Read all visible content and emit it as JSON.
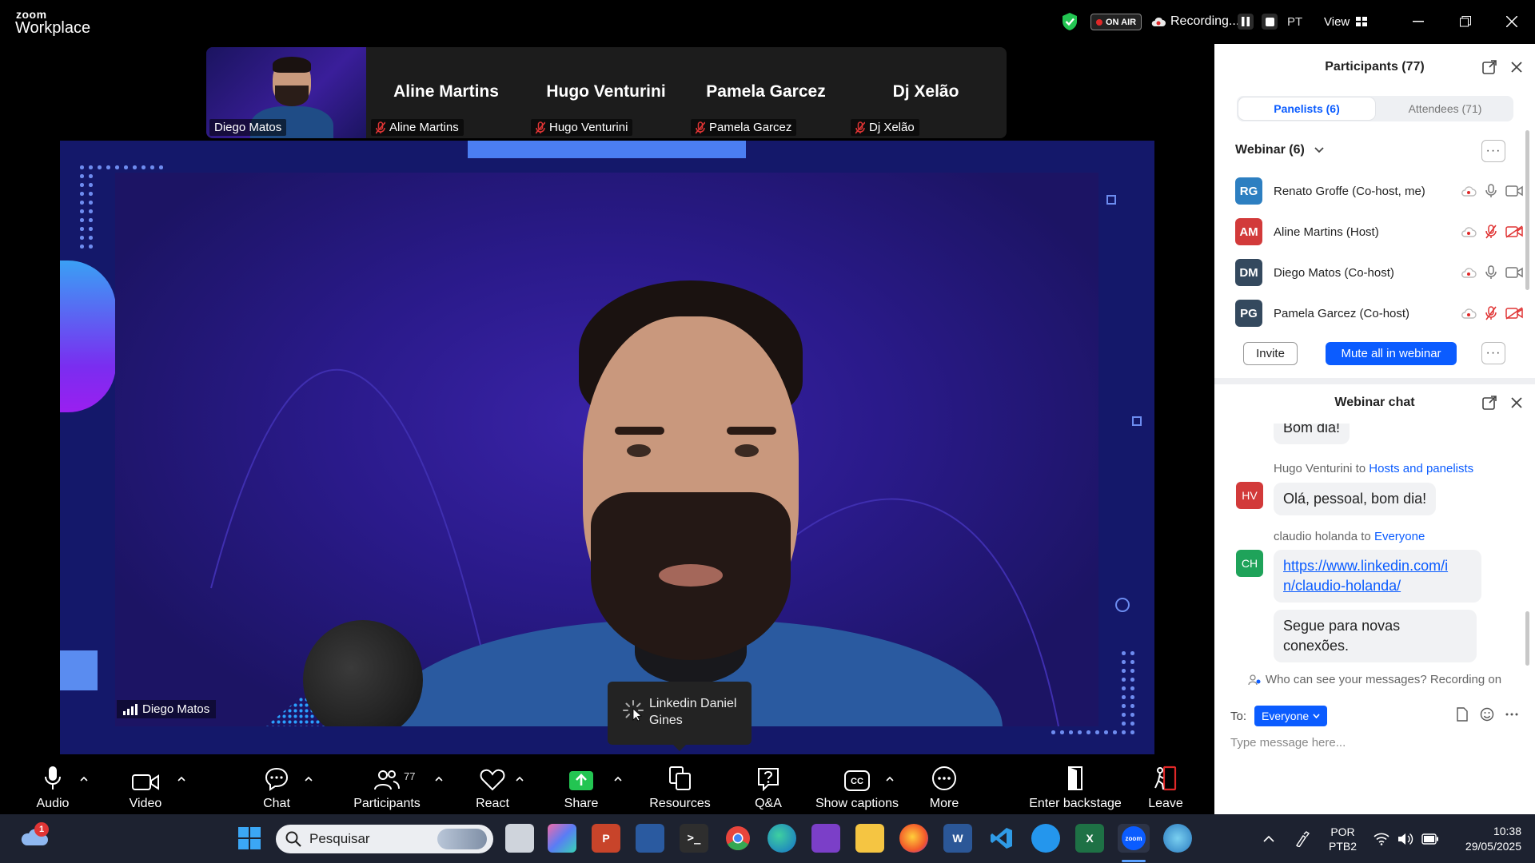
{
  "app": {
    "logo_top": "zoom",
    "logo_bottom": "Workplace",
    "on_air": "ON AIR",
    "recording": "Recording...",
    "language": "PT",
    "view": "View"
  },
  "gallery": {
    "self_label": "Diego Matos",
    "tiles": [
      {
        "name": "Aline Martins",
        "label": "Aline Martins"
      },
      {
        "name": "Hugo Venturini",
        "label": "Hugo Venturini"
      },
      {
        "name": "Pamela Garcez",
        "label": "Pamela Garcez"
      },
      {
        "name": "Dj Xelão",
        "label": "Dj Xelão"
      }
    ]
  },
  "stage": {
    "speaker_label": "Diego Matos",
    "tooltip": "Linkedin Daniel Gines"
  },
  "toolbar": {
    "audio": "Audio",
    "video": "Video",
    "chat": "Chat",
    "participants": "Participants",
    "participants_count": "77",
    "react": "React",
    "share": "Share",
    "resources": "Resources",
    "qa": "Q&A",
    "captions": "Show captions",
    "more": "More",
    "backstage": "Enter backstage",
    "leave": "Leave"
  },
  "participants_panel": {
    "title": "Participants (77)",
    "tab_panelists": "Panelists (6)",
    "tab_attendees": "Attendees (71)",
    "group": "Webinar (6)",
    "rows": [
      {
        "initials": "RG",
        "name": "Renato Groffe (Co-host, me)",
        "color": "#2d7fc1",
        "muted": false
      },
      {
        "initials": "AM",
        "name": "Aline Martins (Host)",
        "color": "#d23a3a",
        "muted": true
      },
      {
        "initials": "DM",
        "name": "Diego Matos (Co-host)",
        "color": "#34495e",
        "muted": false
      },
      {
        "initials": "PG",
        "name": "Pamela Garcez (Co-host)",
        "color": "#34495e",
        "muted": true
      }
    ],
    "invite": "Invite",
    "mute_all": "Mute all in webinar"
  },
  "chat_panel": {
    "title": "Webinar chat",
    "bubble_top": "Bom dia!",
    "msg1_from": "Hugo Venturini",
    "msg1_to_word": "to",
    "msg1_to": "Hosts and panelists",
    "msg1_initials": "HV",
    "msg1_text": "Olá, pessoal, bom dia!",
    "msg2_from": "claudio holanda",
    "msg2_to_word": "to",
    "msg2_to": "Everyone",
    "msg2_initials": "CH",
    "msg2_link": "https://www.linkedin.com/in/claudio-holanda/",
    "msg2_link_line1": "https://www.linkedin.com/i",
    "msg2_link_line2": "n/claudio-holanda/",
    "msg2_text_line1": "Segue para novas",
    "msg2_text_line2": "conexões.",
    "notice": "Who can see your messages? Recording on",
    "to_label": "To:",
    "to_value": "Everyone",
    "input_placeholder": "Type message here..."
  },
  "taskbar": {
    "weather_badge": "1",
    "search_placeholder": "Pesquisar",
    "lang_top": "POR",
    "lang_bottom": "PTB2",
    "time": "10:38",
    "date": "29/05/2025"
  }
}
